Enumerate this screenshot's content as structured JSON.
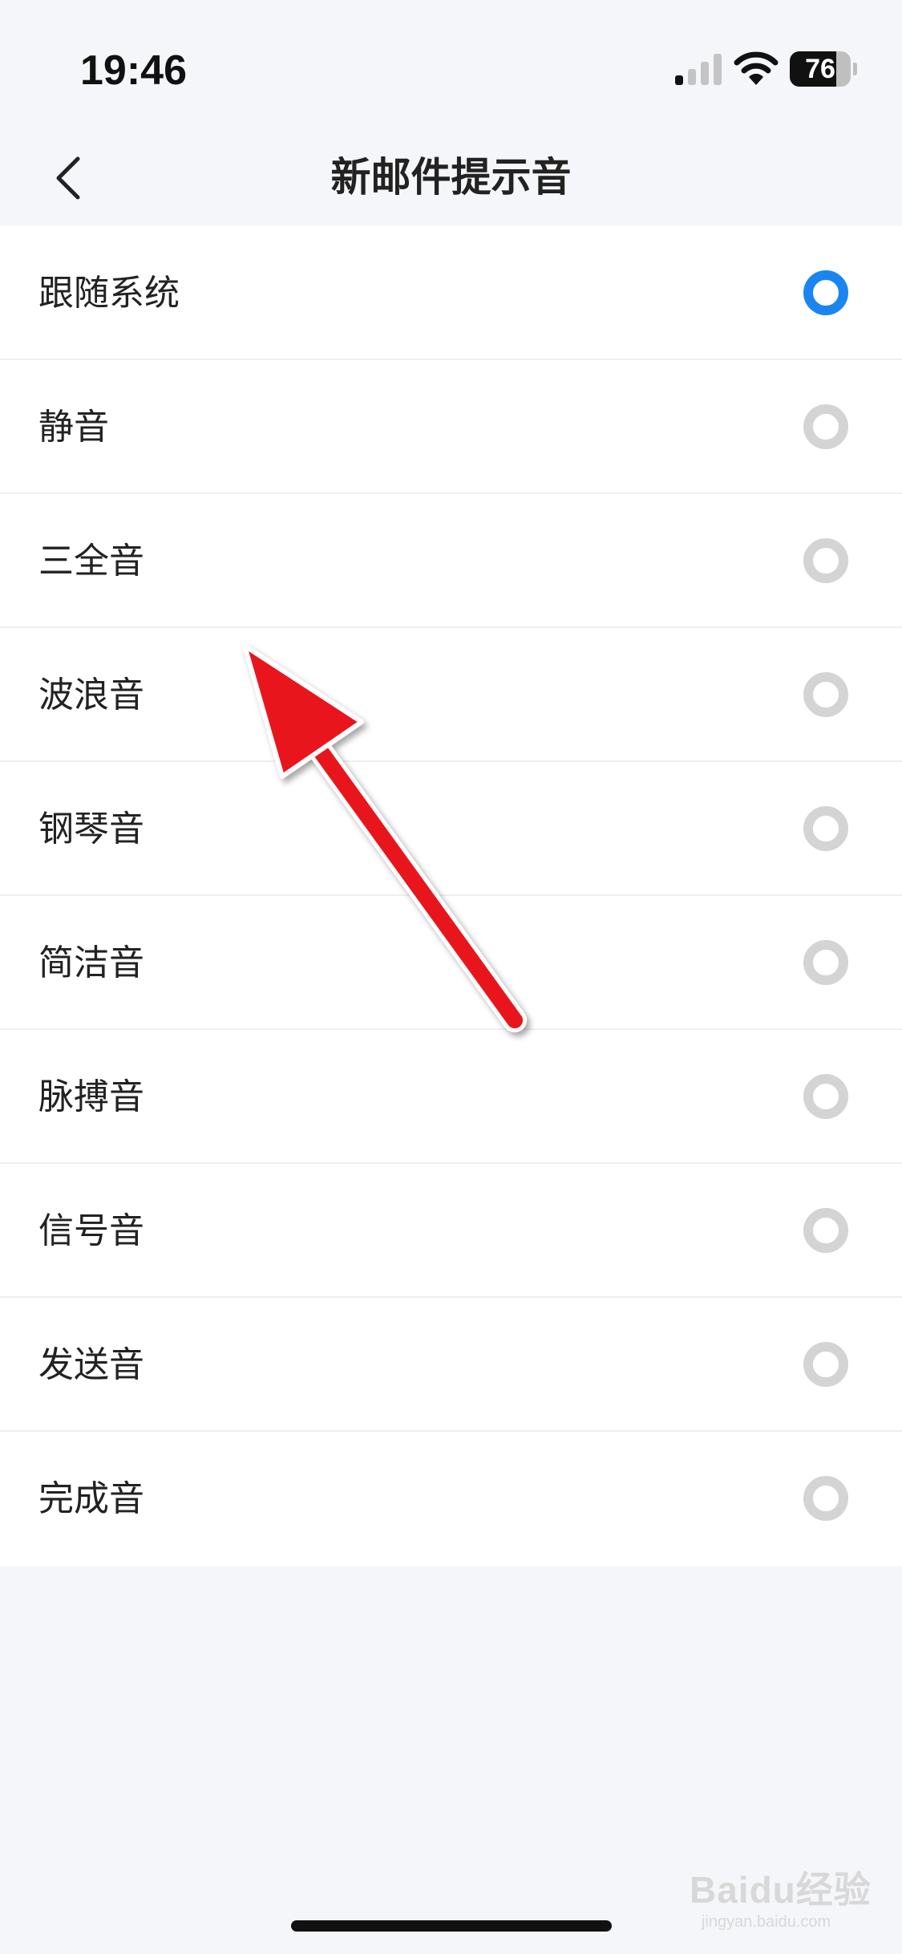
{
  "status_bar": {
    "time": "19:46",
    "battery_level": "76",
    "battery_fraction": 0.76,
    "signal_bars_active": 1,
    "signal_bars_total": 4,
    "icons": [
      "cellular-signal-icon",
      "wifi-icon",
      "battery-icon"
    ]
  },
  "header": {
    "title": "新邮件提示音",
    "back_icon": "chevron-left-icon"
  },
  "sound_options": [
    {
      "label": "跟随系统",
      "selected": true
    },
    {
      "label": "静音",
      "selected": false
    },
    {
      "label": "三全音",
      "selected": false
    },
    {
      "label": "波浪音",
      "selected": false
    },
    {
      "label": "钢琴音",
      "selected": false
    },
    {
      "label": "简洁音",
      "selected": false
    },
    {
      "label": "脉搏音",
      "selected": false
    },
    {
      "label": "信号音",
      "selected": false
    },
    {
      "label": "发送音",
      "selected": false
    },
    {
      "label": "完成音",
      "selected": false
    }
  ],
  "colors": {
    "accent": "#1a85f0",
    "radio_unselected": "#d4d4d4",
    "annotation_arrow": "#e8141c",
    "background": "#f5f6f9"
  },
  "watermark": {
    "brand": "Baidu经验",
    "domain": "jingyan.baidu.com"
  }
}
